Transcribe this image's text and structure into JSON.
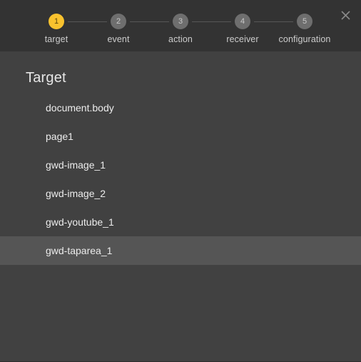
{
  "dialog": {
    "background": "#414141",
    "header_background": "#333333"
  },
  "header": {
    "close_label": "close-icon",
    "accent_color": "#f9c22e",
    "inactive_step_color": "#6e6e6e",
    "steps": [
      {
        "number": "1",
        "label": "target",
        "active": true
      },
      {
        "number": "2",
        "label": "event",
        "active": false
      },
      {
        "number": "3",
        "label": "action",
        "active": false
      },
      {
        "number": "4",
        "label": "receiver",
        "active": false
      },
      {
        "number": "5",
        "label": "configuration",
        "active": false
      }
    ]
  },
  "main": {
    "title": "Target",
    "items": [
      {
        "label": "document.body",
        "selected": false
      },
      {
        "label": "page1",
        "selected": false
      },
      {
        "label": "gwd-image_1",
        "selected": false
      },
      {
        "label": "gwd-image_2",
        "selected": false
      },
      {
        "label": "gwd-youtube_1",
        "selected": false
      },
      {
        "label": "gwd-taparea_1",
        "selected": true
      }
    ]
  }
}
